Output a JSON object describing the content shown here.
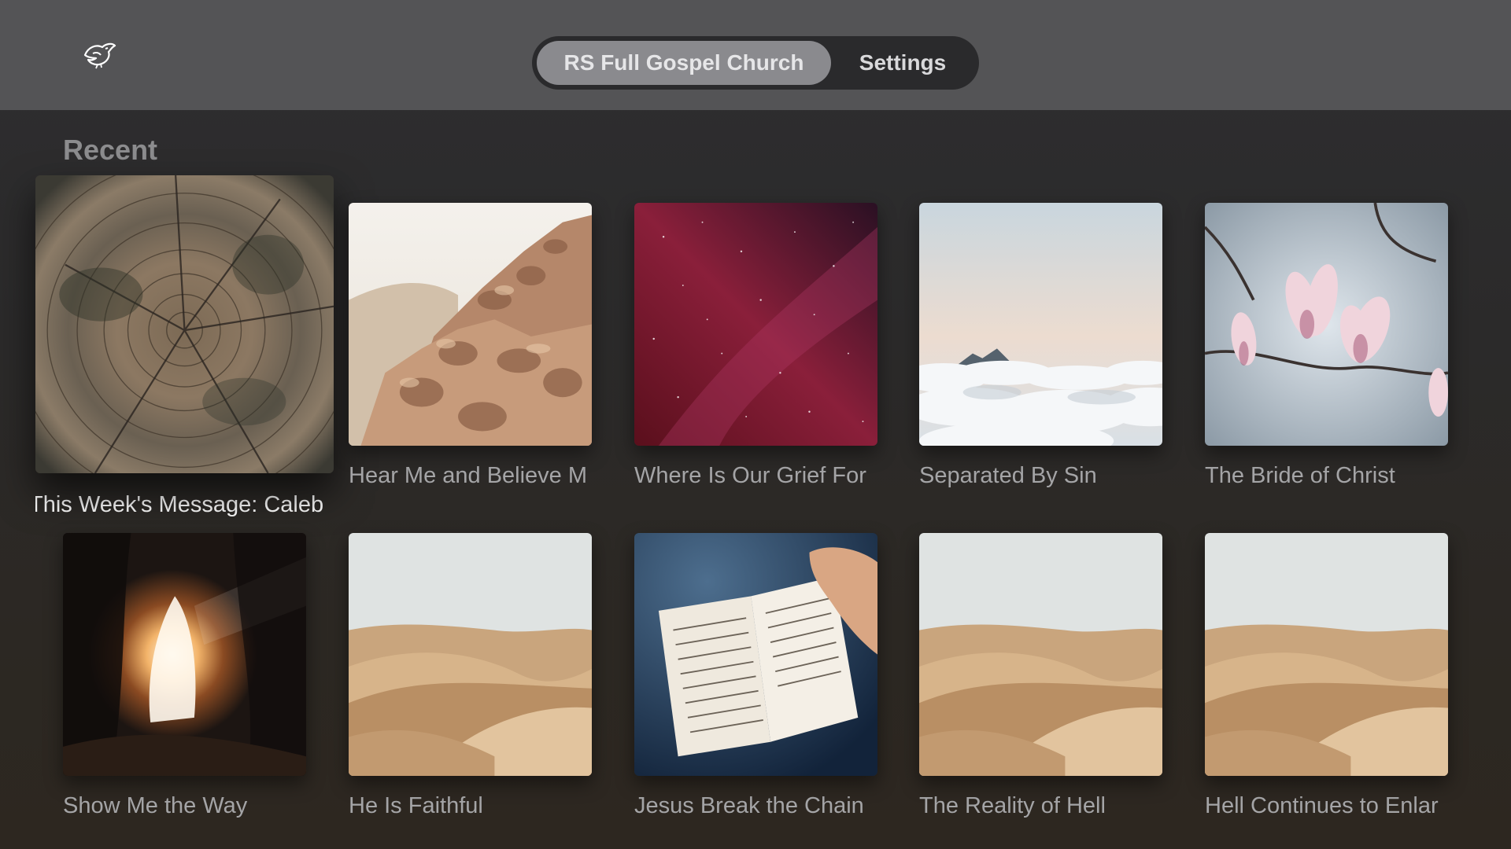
{
  "header": {
    "logo_icon": "dove-icon",
    "tabs": [
      {
        "label": "RS Full Gospel Church",
        "selected": true
      },
      {
        "label": "Settings",
        "selected": false
      }
    ]
  },
  "recent": {
    "title": "Recent",
    "items": [
      {
        "title": "This Week's Message: Caleb",
        "art": "tree-rings",
        "focused": true
      },
      {
        "title": "Hear Me and Believe M",
        "art": "desert-rocks"
      },
      {
        "title": "Where Is Our Grief For",
        "art": "night-sky"
      },
      {
        "title": "Separated By Sin",
        "art": "clouds"
      },
      {
        "title": "The Bride of Christ",
        "art": "magnolia"
      },
      {
        "title": "Show Me the Way",
        "art": "cave-light"
      },
      {
        "title": "He Is Faithful",
        "art": "sand-dunes"
      },
      {
        "title": "Jesus Break the Chain",
        "art": "open-bible"
      },
      {
        "title": "The Reality of Hell",
        "art": "sand-dunes"
      },
      {
        "title": "Hell Continues to Enlar",
        "art": "sand-dunes"
      }
    ]
  }
}
